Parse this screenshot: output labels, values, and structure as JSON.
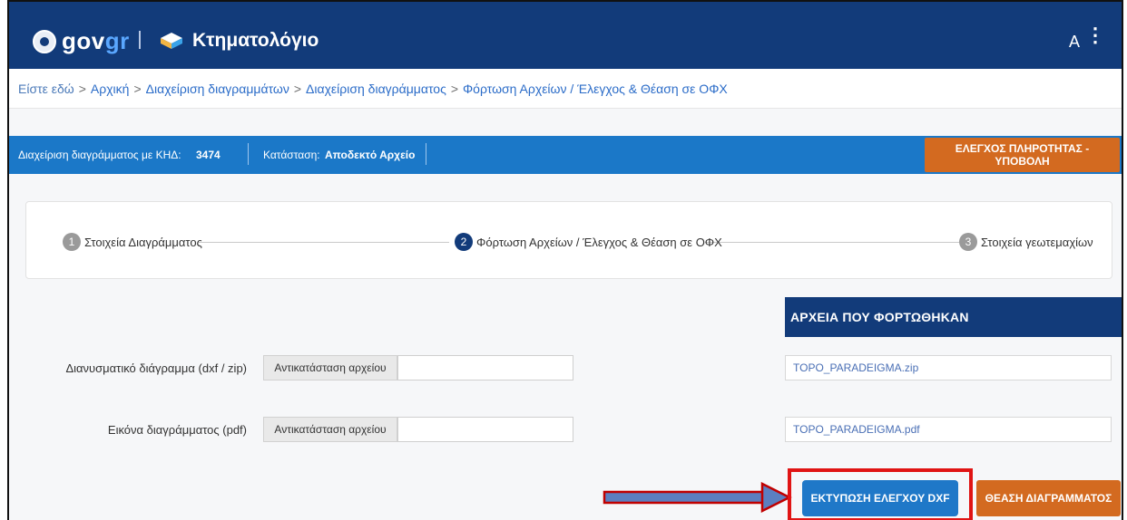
{
  "header": {
    "brand_gov": "gov",
    "brand_gr": "gr",
    "app_title": "Κτηματολόγιο",
    "user_initial": "A",
    "menu_glyph": "⋮"
  },
  "breadcrumbs": {
    "prefix": "Είστε εδώ",
    "separator": ">",
    "items": [
      "Αρχική",
      "Διαχείριση διαγραμμάτων",
      "Διαχείριση διαγράμματος",
      "Φόρτωση Αρχείων / Έλεγχος & Θέαση σε ΟΦΧ"
    ]
  },
  "status_bar": {
    "label_khd": "Διαχείριση διαγράμματος με ΚΗΔ:",
    "khd_value": "3474",
    "label_status": "Κατάσταση:",
    "status_value": "Αποδεκτό Αρχείο",
    "submit_label": "ΕΛΕΓΧΟΣ ΠΛΗΡΟΤΗΤΑΣ - ΥΠΟΒΟΛΗ"
  },
  "stepper": {
    "steps": [
      {
        "num": "1",
        "label": "Στοιχεία Διαγράμματος",
        "state": "inactive"
      },
      {
        "num": "2",
        "label": "Φόρτωση Αρχείων / Έλεγχος & Θέαση σε ΟΦΧ",
        "state": "active"
      },
      {
        "num": "3",
        "label": "Στοιχεία γεωτεμαχίων",
        "state": "inactive"
      }
    ]
  },
  "uploaded_section_title": "ΑΡΧΕΙΑ ΠΟΥ ΦΟΡΤΩΘΗΚΑΝ",
  "form": {
    "rows": [
      {
        "label": "Διανυσματικό διάγραμμα (dxf / zip)",
        "replace_label": "Αντικατάσταση αρχείου",
        "input_value": "",
        "uploaded_file": "TOPO_PARADEIGMA.zip"
      },
      {
        "label": "Εικόνα διαγράμματος (pdf)",
        "replace_label": "Αντικατάσταση αρχείου",
        "input_value": "",
        "uploaded_file": "TOPO_PARADEIGMA.pdf"
      }
    ]
  },
  "actions": {
    "print_dxf_label": "ΕΚΤΥΠΩΣΗ ΕΛΕΓΧΟΥ DXF",
    "view_diagram_label": "ΘΕΑΣΗ ΔΙΑΓΡΑΜΜΑΤΟΣ"
  },
  "colors": {
    "header_bg": "#123b7a",
    "status_bar_bg": "#1b78c8",
    "accent_orange": "#d36a20",
    "primary_blue": "#1f78c8",
    "highlight_red": "#e01414",
    "link_blue": "#2b6cc8"
  },
  "icons": {
    "emblem": "greek-emblem-icon",
    "cadastre": "cadastre-logo-icon",
    "kebab": "kebab-menu-icon"
  }
}
